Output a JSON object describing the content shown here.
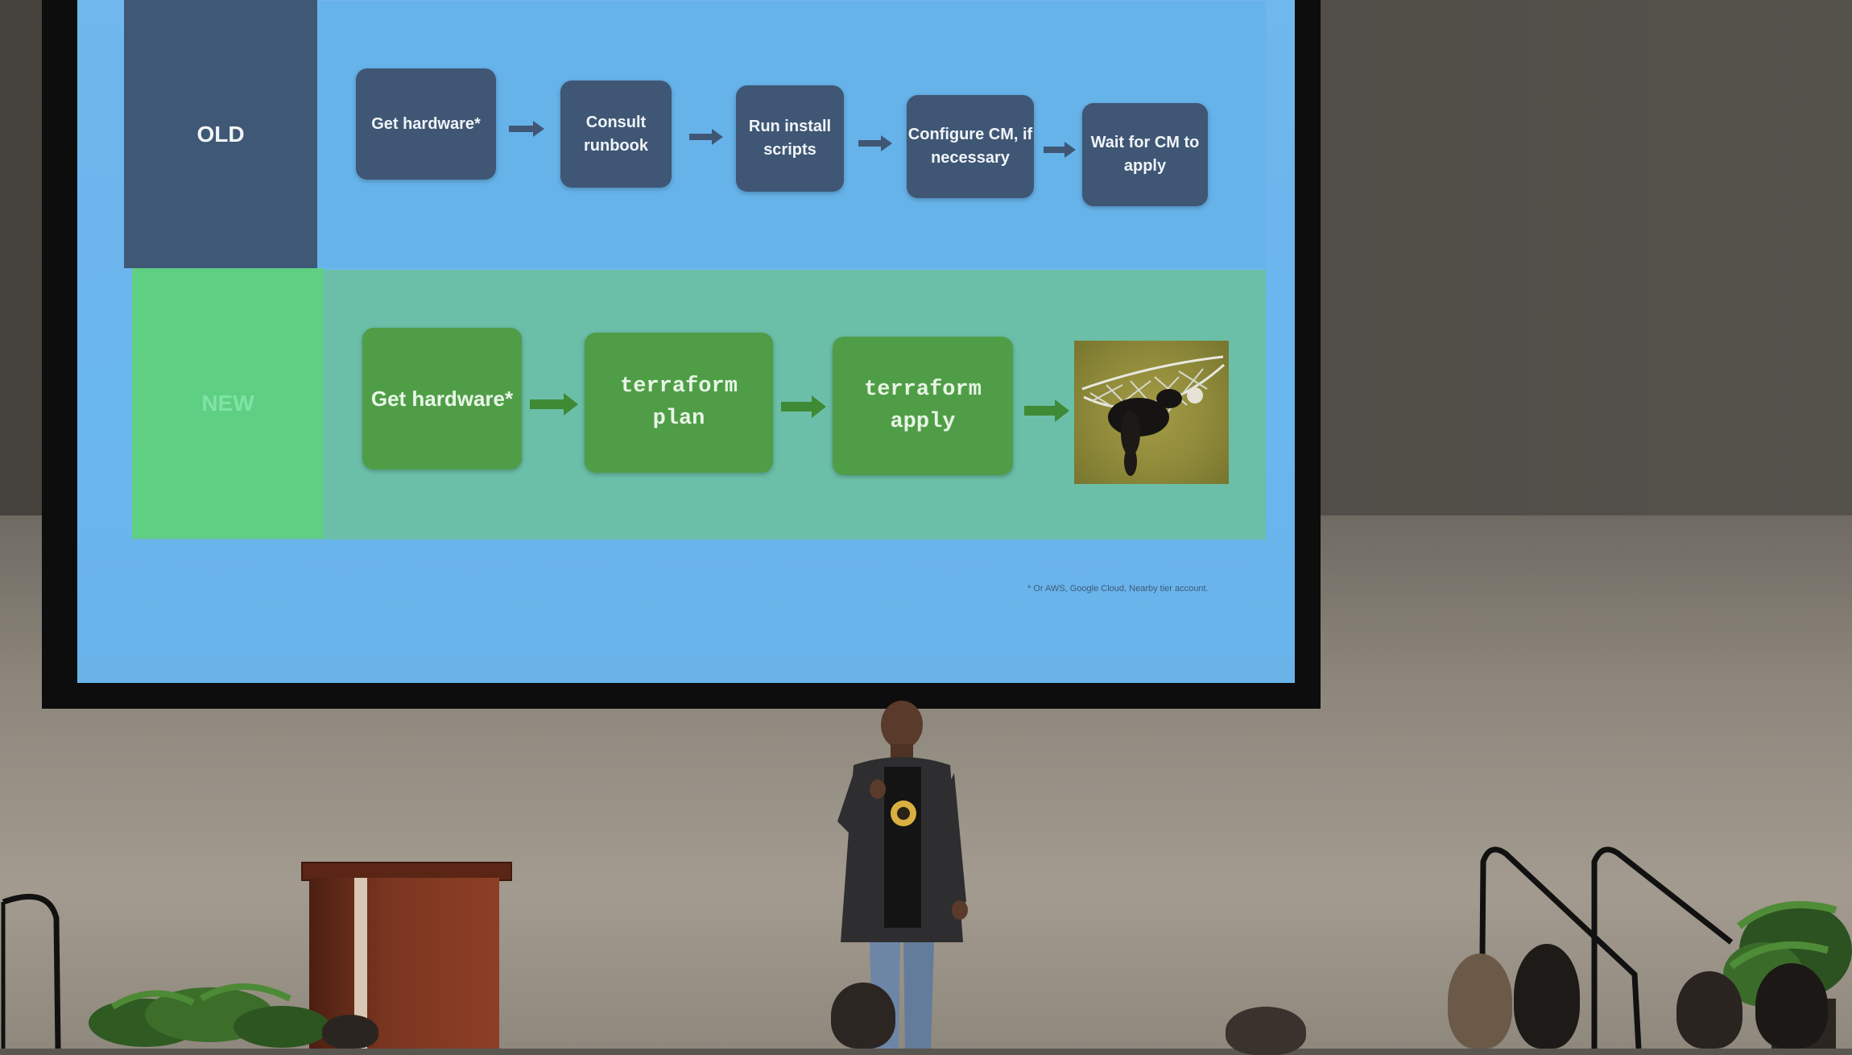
{
  "slide": {
    "old_label": "OLD",
    "new_label": "NEW",
    "old_steps": [
      {
        "line1": "Get hardware*",
        "line2": ""
      },
      {
        "line1": "Consult",
        "line2": "runbook"
      },
      {
        "line1": "Run install",
        "line2": "scripts"
      },
      {
        "line1": "Configure CM, if",
        "line2": "necessary"
      },
      {
        "line1": "Wait for CM to",
        "line2": "apply"
      }
    ],
    "new_steps": [
      {
        "line1": "Get hardware*",
        "line2": ""
      },
      {
        "line1": "terraform",
        "line2": "plan"
      },
      {
        "line1": "terraform",
        "line2": "apply"
      }
    ],
    "footnote": "* Or AWS, Google Cloud, Nearby tier account.",
    "image_icon": "hammock-dog-photo"
  },
  "scene": {
    "stage_icons": [
      "podium",
      "speaker",
      "plant",
      "handrail",
      "audience"
    ]
  },
  "colors": {
    "old_box": "#3f5674",
    "new_box": "#4f9e47",
    "slide_bg": "#6ab6ee",
    "new_label_bg": "#5fd083"
  }
}
